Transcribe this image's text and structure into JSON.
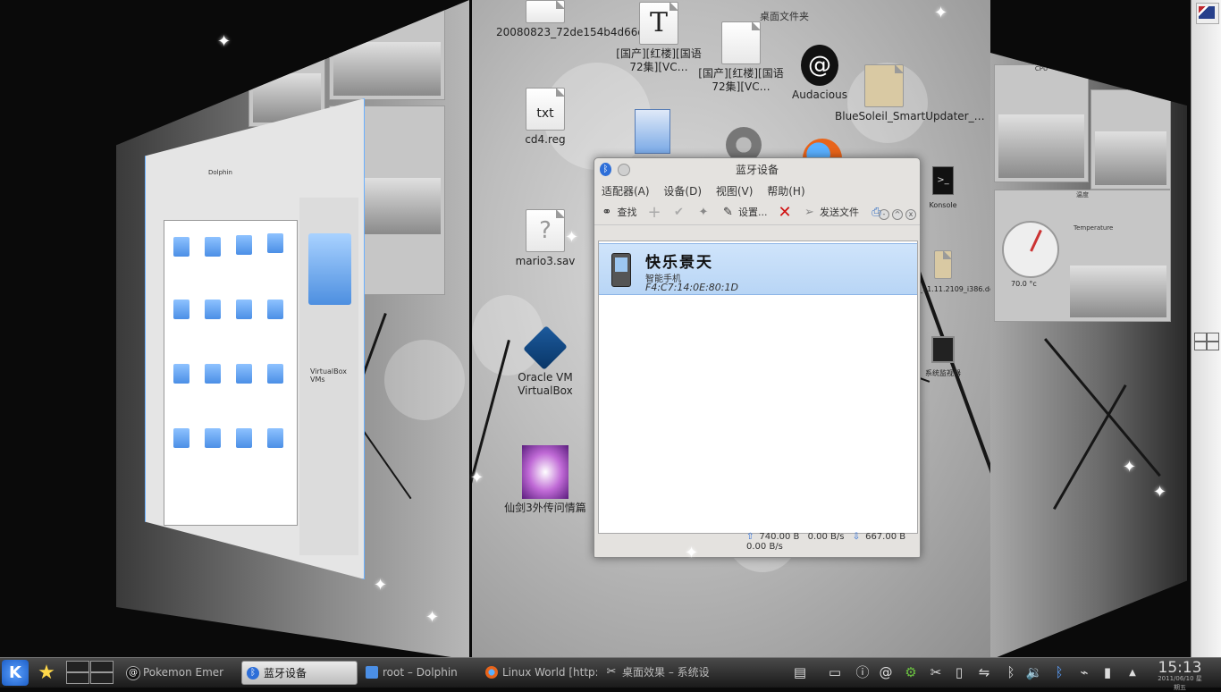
{
  "desktop": {
    "folder_view_title": "桌面文件夹",
    "icons": [
      {
        "label": "20080823_72de154b4d66d…",
        "kind": "file"
      },
      {
        "label": "[国产][红楼][国语72集][VC…",
        "kind": "text"
      },
      {
        "label": "[国产][红楼][国语72集][VC…",
        "kind": "file"
      },
      {
        "label": "Audacious",
        "kind": "app"
      },
      {
        "label": "BlueSoleil_SmartUpdater_…",
        "kind": "file"
      },
      {
        "label": "cd4.reg",
        "kind": "text"
      },
      {
        "label": "mario3.sav",
        "kind": "unknown"
      },
      {
        "label": "Oracle VM VirtualBox",
        "kind": "app"
      },
      {
        "label": "仙剑3外传问情篇",
        "kind": "app"
      },
      {
        "label": "Konsole",
        "kind": "app"
      },
      {
        "label": "opera_11.11.2109_i386.deb",
        "kind": "file"
      },
      {
        "label": "系统监视器",
        "kind": "app"
      }
    ]
  },
  "bluetooth_window": {
    "title": "蓝牙设备",
    "menu": [
      "适配器(A)",
      "设备(D)",
      "视图(V)",
      "帮助(H)"
    ],
    "toolbar": {
      "search": "查找",
      "settings": "设置...",
      "send_file": "发送文件"
    },
    "device": {
      "name": "快乐景天",
      "type": "智能手机",
      "address": "F4:C7:14:0E:80:1D"
    },
    "status": {
      "up": "740.00 B",
      "up_rate": "0.00 B/s",
      "down": "667.00 B",
      "down_rate": "0.00 B/s"
    }
  },
  "file_manager": {
    "side_label": "VirtualBox VMs",
    "title": "Dolphin"
  },
  "widgets": {
    "cpu_title": "CPU",
    "temp_title": "温度",
    "temp_sub": "Temperature",
    "temp_value": "70.0 °c"
  },
  "taskbar": {
    "kde_label": "K",
    "tasks": [
      {
        "label": "Pokemon Emer",
        "icon": "audacious-icon",
        "active": false
      },
      {
        "label": "蓝牙设备",
        "icon": "bluetooth-icon",
        "active": true
      },
      {
        "label": "root – Dolphin",
        "icon": "dolphin-icon",
        "active": false
      },
      {
        "label": "Linux World [http:",
        "icon": "firefox-icon",
        "active": false
      },
      {
        "label": "桌面效果 – 系统设",
        "icon": "tools-icon",
        "active": false
      }
    ],
    "clock": "15:13",
    "clock_sub": "2011/06/10 星期五"
  },
  "colors": {
    "accent": "#2d6ed8",
    "selection": "#bcd7f5",
    "glow": "#6ab0ff"
  }
}
